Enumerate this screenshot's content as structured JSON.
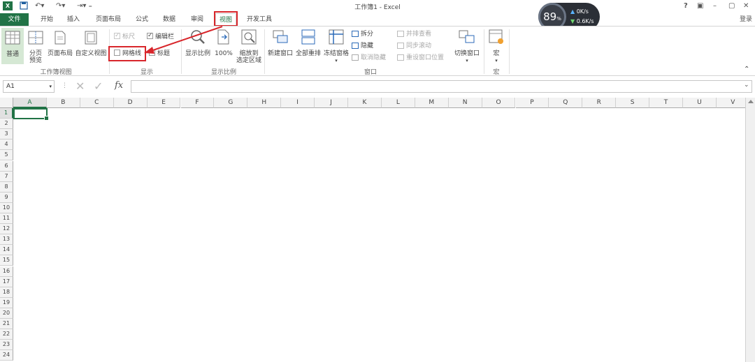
{
  "window": {
    "title": "工作簿1 - Excel",
    "controls": [
      "?",
      "▣",
      "–",
      "▢",
      "✕"
    ],
    "login": "登录"
  },
  "tabs": [
    {
      "label": "文件"
    },
    {
      "label": "开始"
    },
    {
      "label": "插入"
    },
    {
      "label": "页面布局"
    },
    {
      "label": "公式"
    },
    {
      "label": "数据"
    },
    {
      "label": "审阅"
    },
    {
      "label": "视图"
    },
    {
      "label": "开发工具"
    }
  ],
  "active_tab": "视图",
  "ribbon": {
    "workbook_views": {
      "group_label": "工作簿视图",
      "normal": "普通",
      "page_break_1": "分页",
      "page_break_2": "预览",
      "page_layout": "页面布局",
      "custom_views": "自定义视图"
    },
    "show": {
      "group_label": "显示",
      "ruler": "标尺",
      "formula_bar": "编辑栏",
      "gridlines": "网格线",
      "headings": "标题"
    },
    "zoom": {
      "group_label": "显示比例",
      "zoom": "显示比例",
      "zoom100": "100%",
      "zoom_sel_1": "缩放到",
      "zoom_sel_2": "选定区域"
    },
    "window": {
      "group_label": "窗口",
      "new_window": "新建窗口",
      "arrange_all": "全部重排",
      "freeze_panes": "冻结窗格",
      "split": "拆分",
      "hide": "隐藏",
      "unhide": "取消隐藏",
      "side_by_side": "并排查看",
      "sync_scroll": "同步滚动",
      "reset_pos": "重设窗口位置",
      "switch_windows": "切换窗口"
    },
    "macros": {
      "group_label": "宏",
      "macros": "宏"
    }
  },
  "formula_bar": {
    "name_box": "A1",
    "fx": "fx",
    "value": ""
  },
  "columns": [
    "A",
    "B",
    "C",
    "D",
    "E",
    "F",
    "G",
    "H",
    "I",
    "J",
    "K",
    "L",
    "M",
    "N",
    "O",
    "P",
    "Q",
    "R",
    "S",
    "T",
    "U",
    "V"
  ],
  "rows": [
    "1",
    "2",
    "3",
    "4",
    "5",
    "6",
    "7",
    "8",
    "9",
    "10",
    "11",
    "12",
    "13",
    "14",
    "15",
    "16",
    "17",
    "18",
    "19",
    "20",
    "21",
    "22",
    "23",
    "24"
  ],
  "speed_widget": {
    "percent": "89",
    "percent_unit": "%",
    "up": "0K/s",
    "down": "0.6K/s"
  },
  "colors": {
    "accent": "#217346",
    "annotation": "#d8262b"
  }
}
